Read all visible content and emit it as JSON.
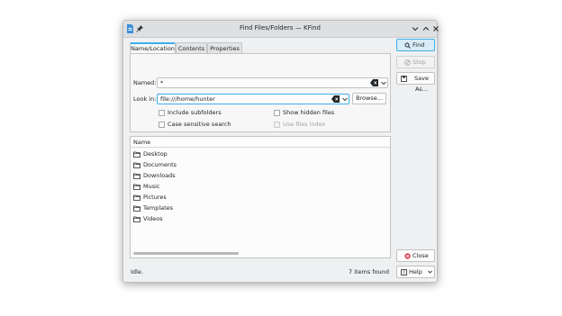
{
  "window": {
    "title": "Find Files/Folders — KFind"
  },
  "tabs": [
    {
      "label": "Name/Location",
      "active": true
    },
    {
      "label": "Contents",
      "active": false
    },
    {
      "label": "Properties",
      "active": false
    }
  ],
  "form": {
    "named_label": "Named:",
    "named_value": "*",
    "lookin_label": "Look in:",
    "lookin_value": "file:///home/hunter",
    "browse_label": "Browse...",
    "include_subfolders": {
      "label": "Include subfolders",
      "checked": false
    },
    "case_sensitive": {
      "label": "Case sensitive search",
      "checked": false
    },
    "show_hidden": {
      "label": "Show hidden files",
      "checked": false
    },
    "use_index": {
      "label": "Use files index",
      "checked": false,
      "enabled": false
    }
  },
  "results": {
    "column_header": "Name",
    "items": [
      "Desktop",
      "Documents",
      "Downloads",
      "Music",
      "Pictures",
      "Templates",
      "Videos"
    ]
  },
  "actions": {
    "find_label": "Find",
    "stop_label": "Stop",
    "save_as_label": "Save As...",
    "close_label": "Close",
    "help_label": "Help"
  },
  "status": {
    "state": "Idle.",
    "count": "7 items found"
  },
  "colors": {
    "accent": "#3daee9",
    "close_icon": "#da4453"
  }
}
